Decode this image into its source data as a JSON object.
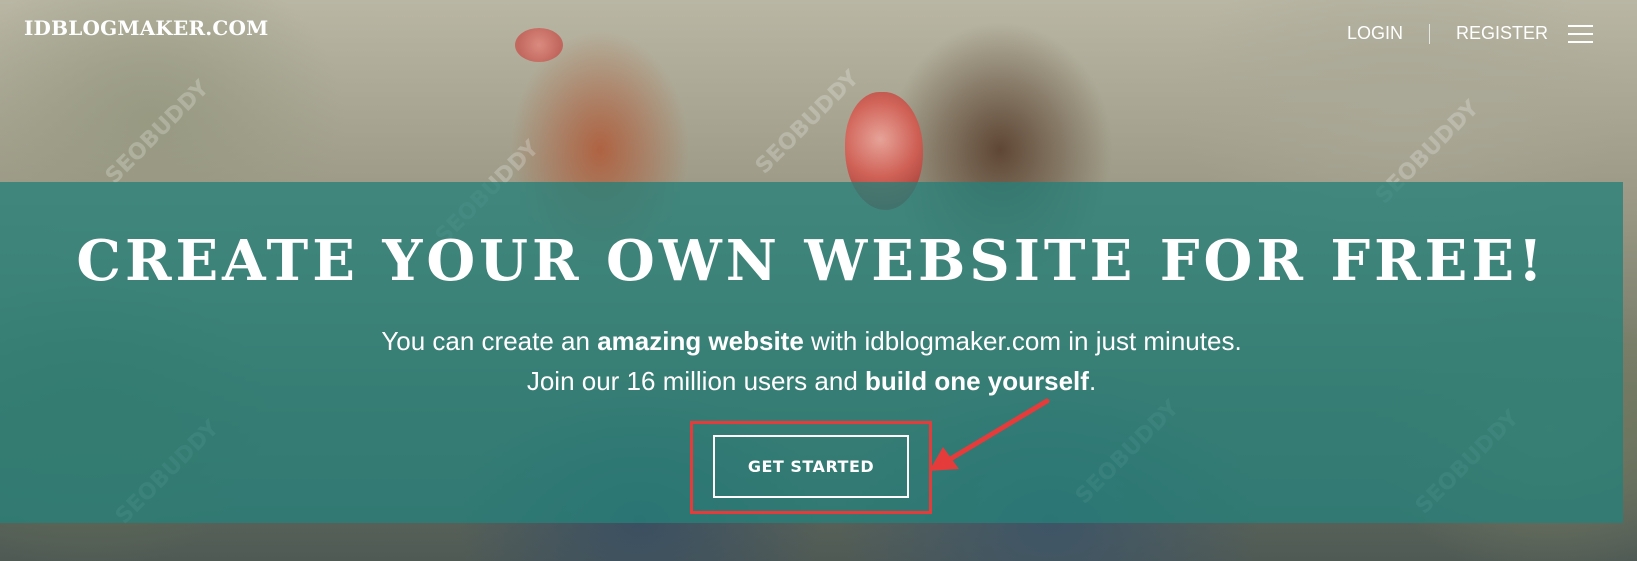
{
  "header": {
    "logo": "IDBLOGMAKER.COM",
    "login_label": "LOGIN",
    "register_label": "REGISTER"
  },
  "hero": {
    "title": "CREATE YOUR OWN WEBSITE FOR FREE!",
    "line1": {
      "part1": "You can create an ",
      "bold1": "amazing website",
      "part2": " with idblogmaker.com in just minutes."
    },
    "line2": {
      "part1": "Join our 16 million users and ",
      "bold1": "build one yourself",
      "part2": "."
    },
    "cta_label": "GET STARTED"
  },
  "watermark_text": "SEOBUDDY",
  "colors": {
    "teal_band": "#26807a",
    "highlight_red": "#e53b3b",
    "text": "#ffffff"
  },
  "icons": {
    "menu": "hamburger-menu-icon",
    "annotation": "red-arrow-icon"
  }
}
